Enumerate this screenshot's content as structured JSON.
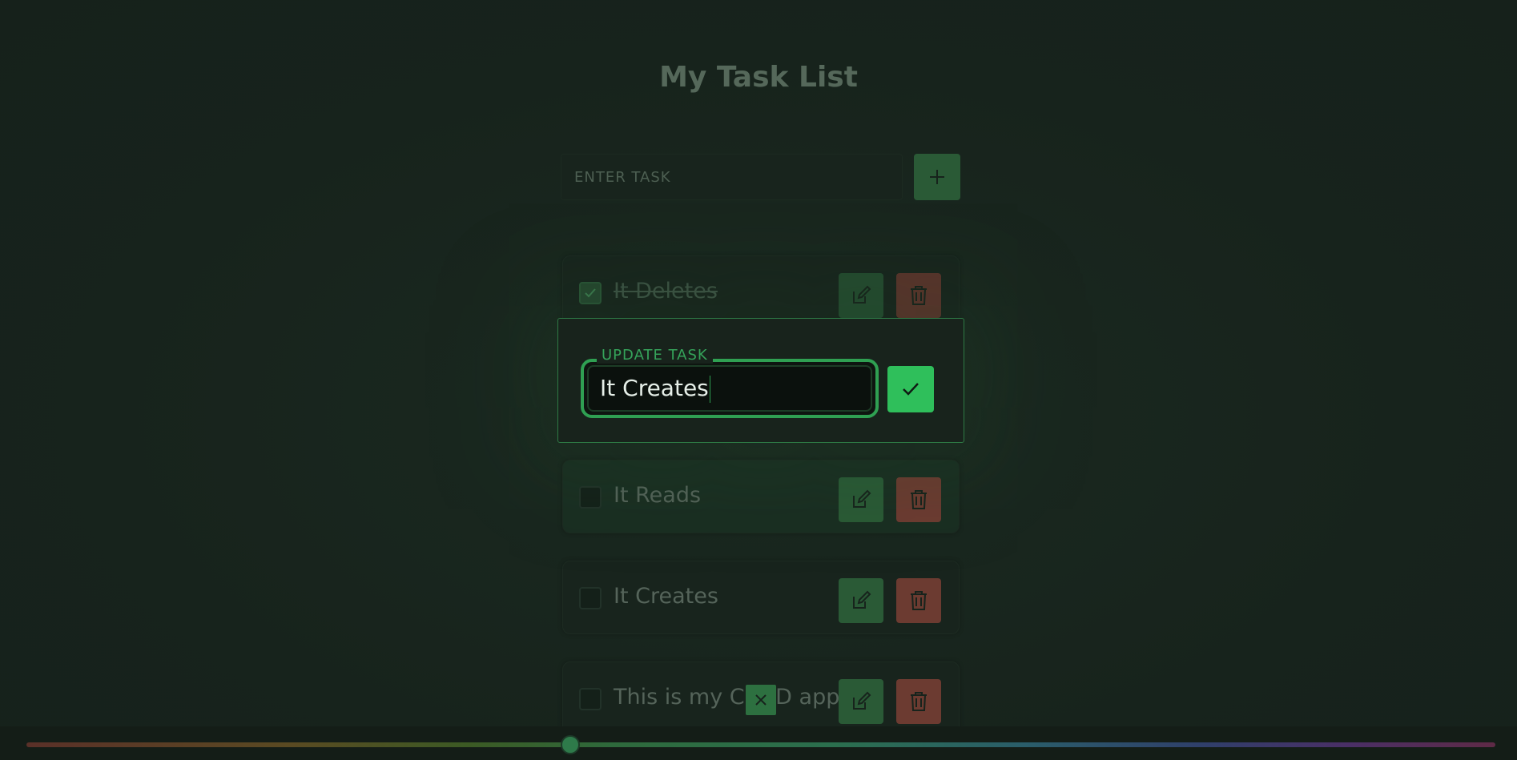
{
  "app": {
    "title": "My Task List"
  },
  "add_task": {
    "placeholder": "ENTER TASK",
    "add_button_icon": "plus-icon"
  },
  "tasks": [
    {
      "label": "It Deletes",
      "completed": true
    },
    {
      "label": "It Reads",
      "completed": false
    },
    {
      "label": "It Creates",
      "completed": false
    },
    {
      "label": "This is my CRUD app",
      "completed": false
    }
  ],
  "update_dialog": {
    "legend": "UPDATE TASK",
    "value": "It Creates",
    "confirm_icon": "check-icon",
    "close_icon": "close-icon"
  },
  "hue_slider": {
    "value": 0.37
  },
  "colors": {
    "accent_green": "#2fbf5b",
    "delete_red": "#6c3b31",
    "background": "#17231c"
  }
}
